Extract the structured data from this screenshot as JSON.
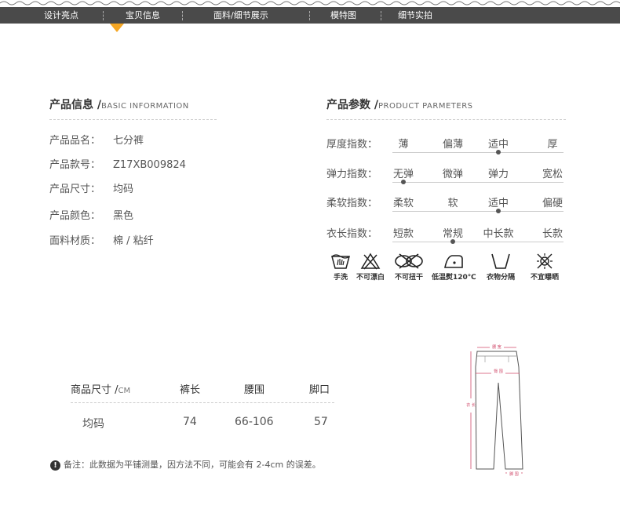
{
  "nav": {
    "items": [
      "设计亮点",
      "宝贝信息",
      "面料/细节展示",
      "模特图",
      "细节实拍"
    ],
    "active_index": 1,
    "pointer_color": "#f5a623"
  },
  "product_info": {
    "title": "产品信息 /",
    "title_en": "BASIC INFORMATION",
    "rows": [
      {
        "label": "产品品名：",
        "value": "七分裤"
      },
      {
        "label": "产品款号：",
        "value": "Z17XB009824"
      },
      {
        "label": "产品尺寸：",
        "value": "均码"
      },
      {
        "label": "产品颜色：",
        "value": "黑色"
      },
      {
        "label": "面料材质：",
        "value": "棉 / 粘纤"
      }
    ]
  },
  "product_params": {
    "title": "产品参数 /",
    "title_en": "PRODUCT PARMETERS",
    "rows": [
      {
        "label": "厚度指数：",
        "options": [
          "薄",
          "偏薄",
          "适中",
          "厚"
        ],
        "selected_index": 2
      },
      {
        "label": "弹力指数：",
        "options": [
          "无弹",
          "微弹",
          "弹力",
          "宽松"
        ],
        "selected_index": 0
      },
      {
        "label": "柔软指数：",
        "options": [
          "柔软",
          "软",
          "适中",
          "偏硬"
        ],
        "selected_index": 2
      },
      {
        "label": "衣长指数：",
        "options": [
          "短款",
          "常规",
          "中长款",
          "长款"
        ],
        "selected_index": 1
      }
    ]
  },
  "care": [
    {
      "icon": "hand-wash-icon",
      "label": "手洗"
    },
    {
      "icon": "no-bleach-icon",
      "label": "不可漂白"
    },
    {
      "icon": "no-wring-icon",
      "label": "不可扭干"
    },
    {
      "icon": "low-iron-icon",
      "label": "低温熨120℃"
    },
    {
      "icon": "shade-dry-icon",
      "label": "衣物分隔"
    },
    {
      "icon": "no-sun-icon",
      "label": "不宜曝晒"
    }
  ],
  "size_table": {
    "header_label": "商品尺寸 /",
    "header_unit": "CM",
    "columns": [
      "裤长",
      "腰围",
      "脚口"
    ],
    "row": {
      "size": "均码",
      "values": [
        "74",
        "66-106",
        "57"
      ]
    }
  },
  "note": {
    "icon": "exclamation-icon",
    "text": "备注：此数据为平铺测量，因方法不同，可能会有 2-4cm 的误差。"
  },
  "diagram": {
    "labels": {
      "waist": "腰 宽",
      "hip": "臀 围",
      "length": "衣 长",
      "hem": "脚 围"
    }
  }
}
